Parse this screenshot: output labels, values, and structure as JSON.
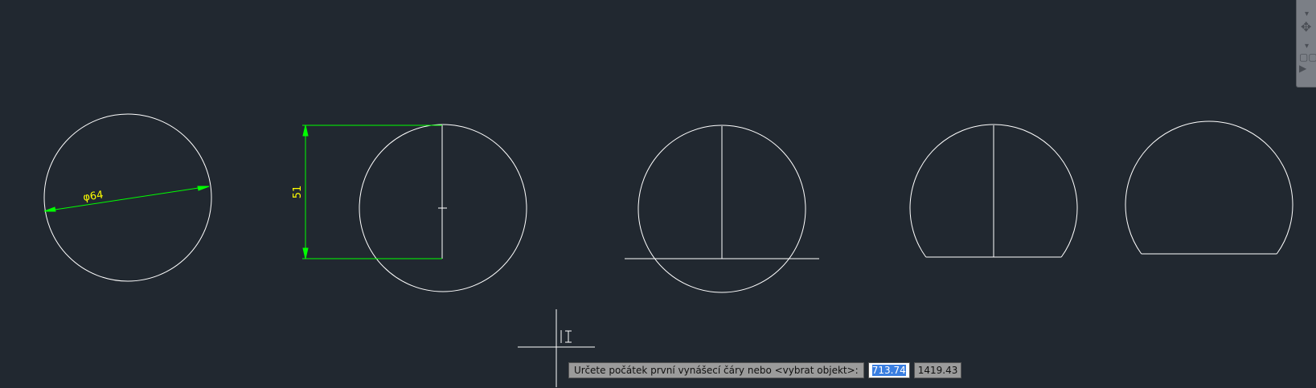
{
  "drawing": {
    "colors": {
      "geometry": "#ffffff",
      "dimension": "#00ff00",
      "dim_text": "#ffff00",
      "background": "#212830"
    },
    "dimensions": {
      "diameter_text": "φ64",
      "linear_text": "51"
    }
  },
  "dynamic_input": {
    "prompt": "Určete počátek první vynášecí čáry nebo <vybrat objekt>:",
    "x_value": "713.74",
    "y_value": "1419.43"
  },
  "navigation_bar": {
    "icons": [
      "pan-icon",
      "steering-wheel-icon",
      "showmotion-icon"
    ]
  }
}
